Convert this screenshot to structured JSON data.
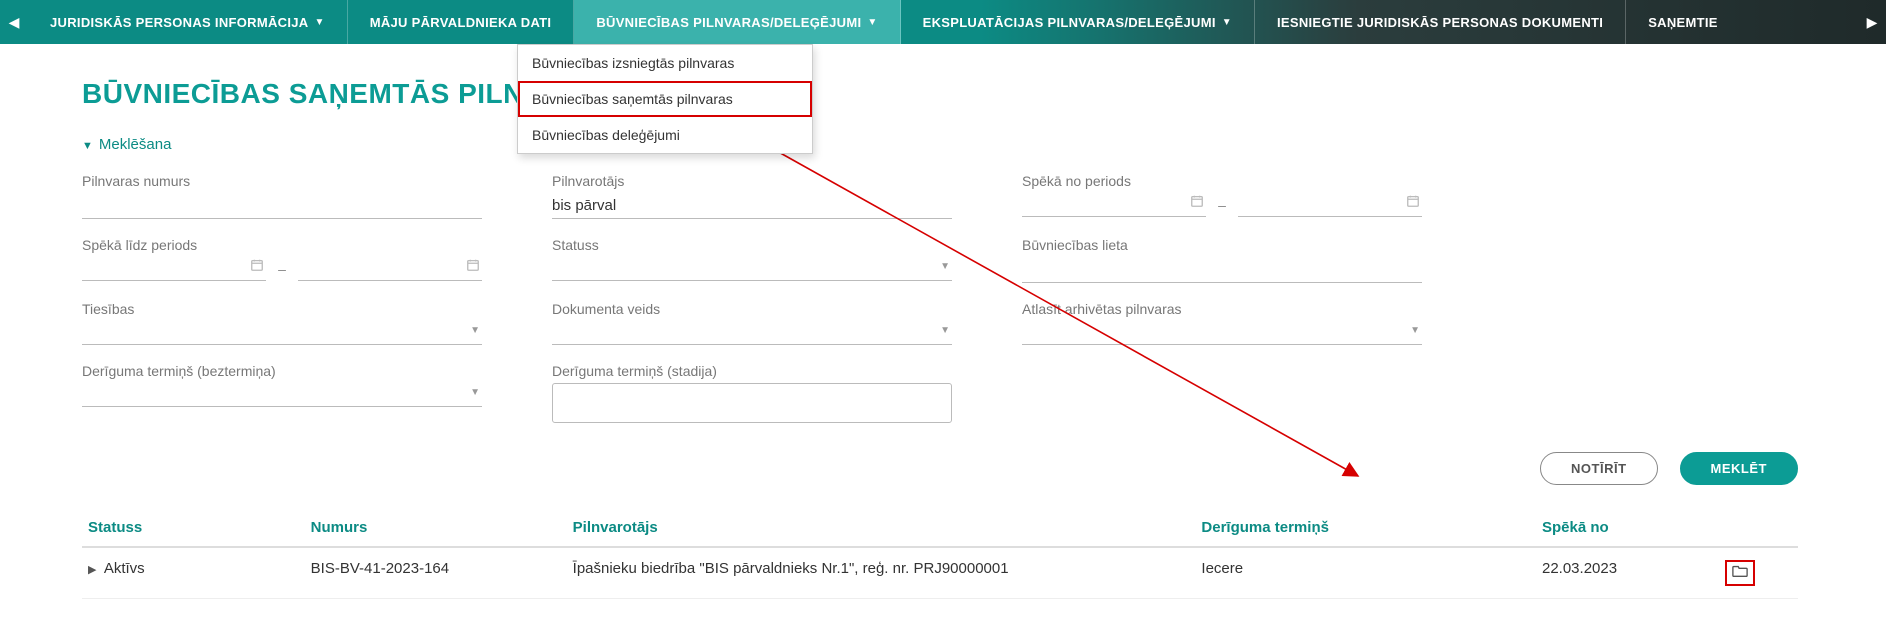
{
  "nav": {
    "items": [
      {
        "label": "JURIDISKĀS PERSONAS INFORMĀCIJA",
        "caret": true,
        "active": false
      },
      {
        "label": "MĀJU PĀRVALDNIEKA DATI",
        "caret": false,
        "active": false
      },
      {
        "label": "BŪVNIECĪBAS PILNVARAS/DELEĢĒJUMI",
        "caret": true,
        "active": true
      },
      {
        "label": "EKSPLUATĀCIJAS PILNVARAS/DELEĢĒJUMI",
        "caret": true,
        "active": false
      },
      {
        "label": "IESNIEGTIE JURIDISKĀS PERSONAS DOKUMENTI",
        "caret": false,
        "active": false
      },
      {
        "label": "SAŅEMTIE",
        "caret": false,
        "active": false
      }
    ]
  },
  "dropdown": {
    "items": [
      {
        "label": "Būvniecības izsniegtās pilnvaras",
        "highlight": false
      },
      {
        "label": "Būvniecības saņemtās pilnvaras",
        "highlight": true
      },
      {
        "label": "Būvniecības deleģējumi",
        "highlight": false
      }
    ]
  },
  "page_title": "BŪVNIECĪBAS SAŅEMTĀS PILNVARAS",
  "search_toggle": "Meklēšana",
  "fields": {
    "pilnvaras_numurs": {
      "label": "Pilnvaras numurs",
      "value": ""
    },
    "pilnvarotajs": {
      "label": "Pilnvarotājs",
      "value": "bis pārval"
    },
    "speka_no": {
      "label": "Spēkā no periods"
    },
    "speka_lidz": {
      "label": "Spēkā līdz periods"
    },
    "statuss": {
      "label": "Statuss"
    },
    "buvniecibas_lieta": {
      "label": "Būvniecības lieta",
      "value": ""
    },
    "tiesibas": {
      "label": "Tiesības"
    },
    "dokumenta_veids": {
      "label": "Dokumenta veids"
    },
    "atlasit_arhivetas": {
      "label": "Atlasīt arhivētas pilnvaras"
    },
    "deriguma_bez": {
      "label": "Derīguma termiņš (beztermiņa)"
    },
    "deriguma_stad": {
      "label": "Derīguma termiņš (stadija)"
    }
  },
  "buttons": {
    "clear": "NOTĪRĪT",
    "search": "MEKLĒT"
  },
  "table": {
    "headers": {
      "statuss": "Statuss",
      "numurs": "Numurs",
      "pilnvarotajs": "Pilnvarotājs",
      "deriguma": "Derīguma termiņš",
      "speka_no": "Spēkā no"
    },
    "rows": [
      {
        "statuss": "Aktīvs",
        "numurs": "BIS-BV-41-2023-164",
        "pilnvarotajs": "Īpašnieku biedrība \"BIS pārvaldnieks Nr.1\", reģ. nr. PRJ90000001",
        "deriguma": "Iecere",
        "speka_no": "22.03.2023"
      }
    ]
  },
  "dash": "–"
}
